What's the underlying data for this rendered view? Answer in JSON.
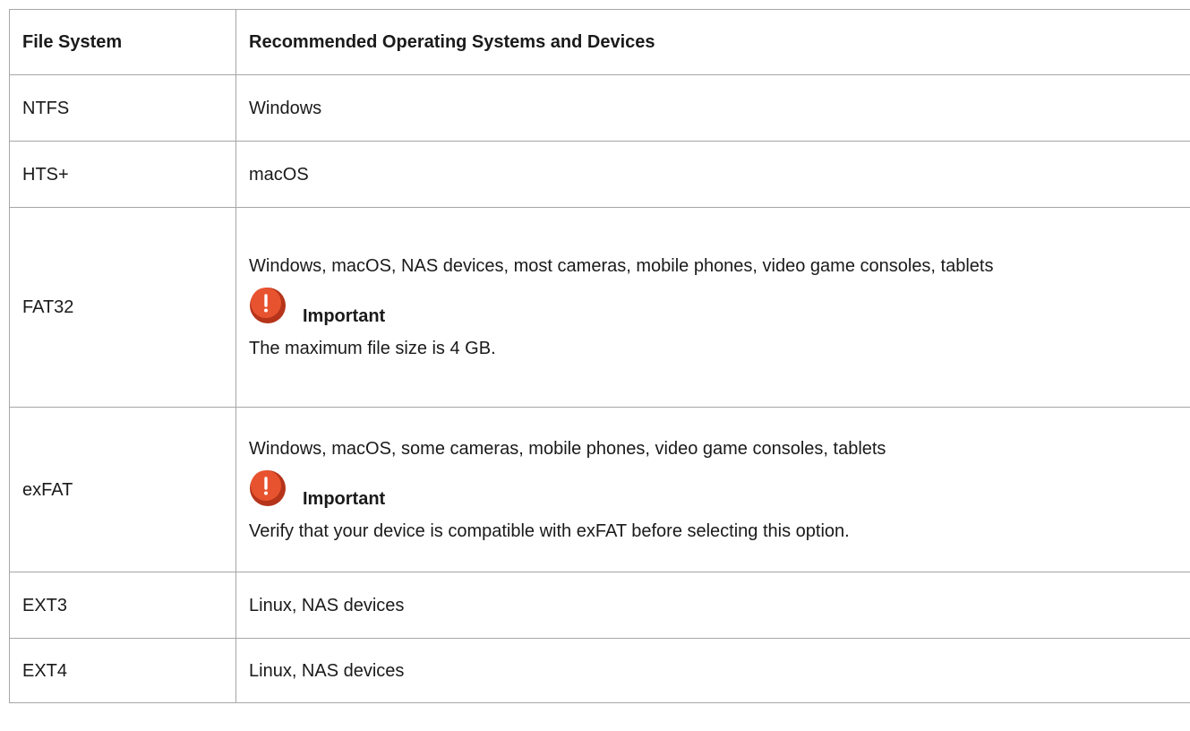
{
  "table": {
    "headers": [
      "File System",
      "Recommended Operating Systems and Devices"
    ],
    "rows": [
      {
        "fs": "NTFS",
        "systems": "Windows"
      },
      {
        "fs": "HTS+",
        "systems": "macOS"
      },
      {
        "fs": "FAT32",
        "systems": "Windows, macOS, NAS devices, most cameras, mobile phones, video game consoles, tablets",
        "note_label": "Important",
        "note_text": "The maximum file size is 4 GB."
      },
      {
        "fs": "exFAT",
        "systems": "Windows, macOS, some cameras, mobile phones, video game consoles, tablets",
        "note_label": "Important",
        "note_text": "Verify that your device is compatible with exFAT before selecting this option."
      },
      {
        "fs": "EXT3",
        "systems": "Linux, NAS devices"
      },
      {
        "fs": "EXT4",
        "systems": "Linux, NAS devices"
      }
    ]
  },
  "icons": {
    "important": "important-warning-icon"
  },
  "colors": {
    "border": "#a6a6a6",
    "icon_fill": "#e8532f",
    "icon_shadow": "#b5341a",
    "text": "#1a1a1a"
  }
}
